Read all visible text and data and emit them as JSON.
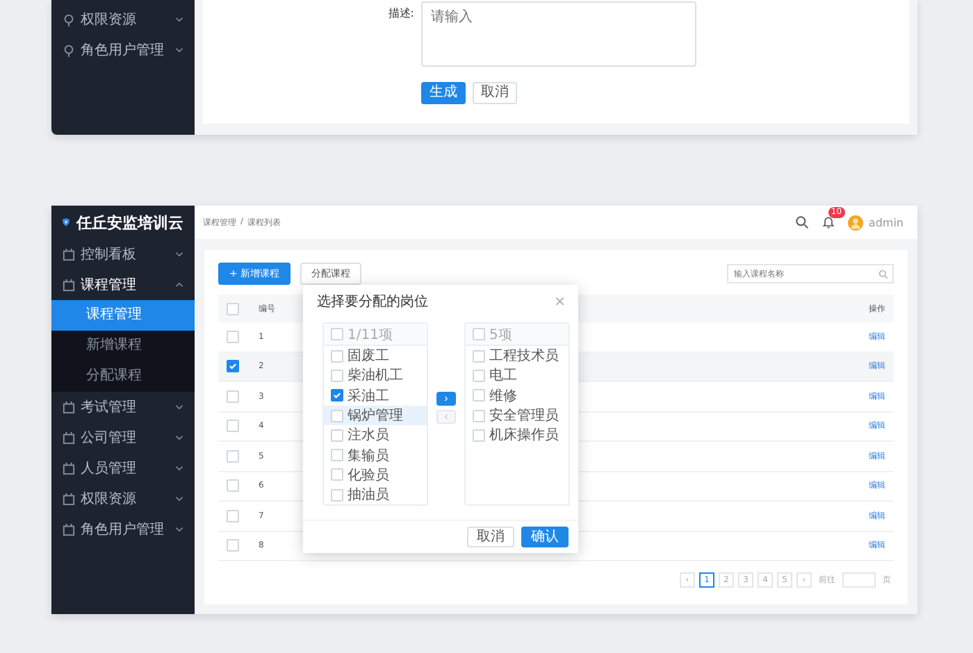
{
  "top_panel": {
    "sidebar": {
      "items": [
        {
          "label": "权限资源",
          "expanded": false
        },
        {
          "label": "角色用户管理",
          "expanded": false
        }
      ]
    },
    "form": {
      "label": "描述:",
      "placeholder": "请输入",
      "buttons": [
        {
          "label": "生成",
          "primary": true
        },
        {
          "label": "取消",
          "primary": false
        }
      ]
    }
  },
  "main_panel": {
    "logo": "任丘安监培训云",
    "sidebar": {
      "items": [
        {
          "label": "控制看板",
          "expanded": false
        },
        {
          "label": "课程管理",
          "expanded": true,
          "children": [
            {
              "label": "课程管理",
              "selected": true
            },
            {
              "label": "新增课程",
              "selected": false
            },
            {
              "label": "分配课程",
              "selected": false
            }
          ]
        },
        {
          "label": "考试管理",
          "expanded": false
        },
        {
          "label": "公司管理",
          "expanded": false
        },
        {
          "label": "人员管理",
          "expanded": false
        },
        {
          "label": "权限资源",
          "expanded": false
        },
        {
          "label": "角色用户管理",
          "expanded": false
        }
      ]
    },
    "breadcrumb": [
      "课程管理",
      "/",
      "课程列表"
    ],
    "header": {
      "notification_count": "10",
      "user": "admin"
    },
    "toolbar": {
      "buttons": [
        {
          "label": "+ 新增课程",
          "primary": true
        },
        {
          "label": "分配课程",
          "primary": false
        }
      ],
      "search_placeholder": "输入课程名称"
    },
    "table": {
      "select_all": false,
      "columns": [
        "编号",
        "操作"
      ],
      "rows": [
        {
          "no": "1",
          "checked": false,
          "action": "编辑"
        },
        {
          "no": "2",
          "checked": true,
          "action": "编辑"
        },
        {
          "no": "3",
          "checked": false,
          "action": "编辑"
        },
        {
          "no": "4",
          "checked": false,
          "action": "编辑"
        },
        {
          "no": "5",
          "checked": false,
          "action": "编辑"
        },
        {
          "no": "6",
          "checked": false,
          "action": "编辑"
        },
        {
          "no": "7",
          "checked": false,
          "action": "编辑"
        },
        {
          "no": "8",
          "checked": false,
          "action": "编辑"
        }
      ]
    },
    "pagination": {
      "prev": "‹",
      "pages": [
        {
          "label": "1",
          "selected": true
        },
        {
          "label": "2",
          "selected": false
        },
        {
          "label": "3",
          "selected": false
        },
        {
          "label": "4",
          "selected": false
        },
        {
          "label": "5",
          "selected": false
        }
      ],
      "next": "›",
      "goto": "前往",
      "unit": "页"
    },
    "dialog": {
      "title": "选择要分配的岗位",
      "close": "×",
      "left": {
        "header": "1/11项",
        "checked": false,
        "items": [
          {
            "label": "固废工",
            "checked": false,
            "hovered": false
          },
          {
            "label": "柴油机工",
            "checked": false,
            "hovered": false
          },
          {
            "label": "采油工",
            "checked": true,
            "hovered": false
          },
          {
            "label": "锅炉管理",
            "checked": false,
            "hovered": true
          },
          {
            "label": "注水员",
            "checked": false,
            "hovered": false
          },
          {
            "label": "集输员",
            "checked": false,
            "hovered": false
          },
          {
            "label": "化验员",
            "checked": false,
            "hovered": false
          },
          {
            "label": "抽油员",
            "checked": false,
            "hovered": false
          }
        ]
      },
      "transfer": [
        {
          "label": "›",
          "disabled": false
        },
        {
          "label": "‹",
          "disabled": true
        }
      ],
      "right": {
        "header": "5项",
        "checked": false,
        "items": [
          {
            "label": "工程技术员",
            "checked": false,
            "hovered": false
          },
          {
            "label": "电工",
            "checked": false,
            "hovered": false
          },
          {
            "label": "维修",
            "checked": false,
            "hovered": false
          },
          {
            "label": "安全管理员",
            "checked": false,
            "hovered": false
          },
          {
            "label": "机床操作员",
            "checked": false,
            "hovered": false
          }
        ]
      },
      "buttons": [
        {
          "label": "取消",
          "primary": false
        },
        {
          "label": "确认",
          "primary": true
        }
      ]
    }
  }
}
